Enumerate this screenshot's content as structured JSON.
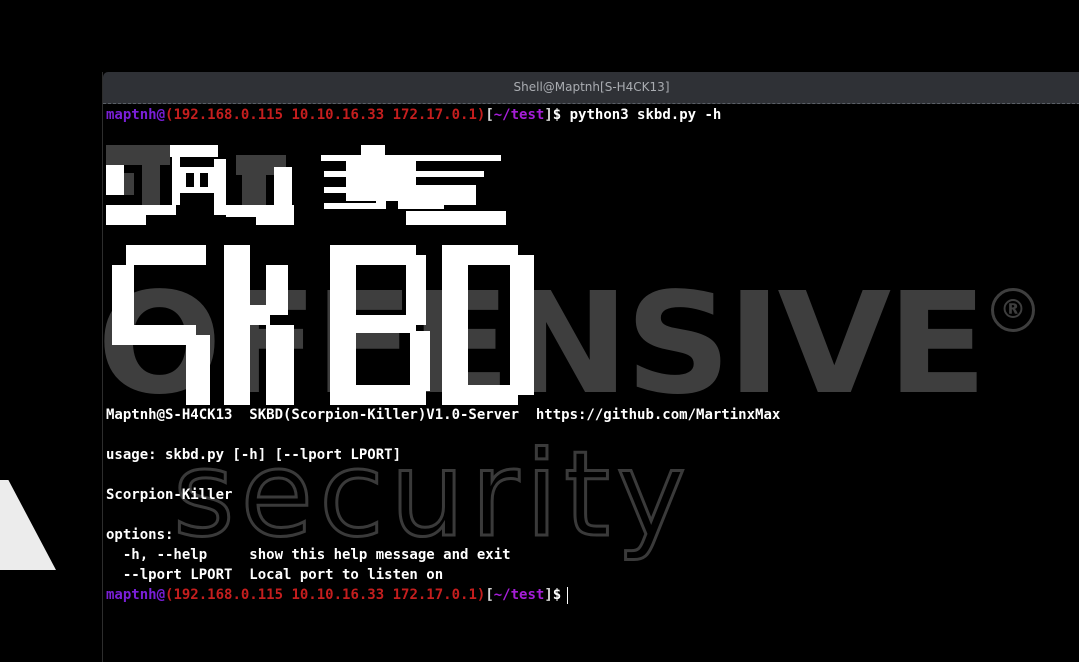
{
  "window": {
    "title": "Shell@Maptnh[S-H4CK13]"
  },
  "watermark": {
    "word_main": "OFFENSIVE",
    "word_sub": "security",
    "registered": "®"
  },
  "prompt": {
    "user": "maptnh@",
    "ips": "(192.168.0.115 10.10.16.33 172.17.0.1)",
    "bracket_open": "[",
    "path": "~/test",
    "bracket_close": "]",
    "sign": "$"
  },
  "command": " python3 skbd.py -h",
  "banner_alt": "SKBD",
  "output": {
    "info_line": "Maptnh@S-H4CK13  SKBD(Scorpion-Killer)V1.0-Server  https://github.com/MartinxMax",
    "usage": "usage: skbd.py [-h] [--lport LPORT]",
    "description": "Scorpion-Killer",
    "options_header": "options:",
    "opt_help": "  -h, --help     show this help message and exit",
    "opt_lport": "  --lport LPORT  Local port to listen on"
  }
}
